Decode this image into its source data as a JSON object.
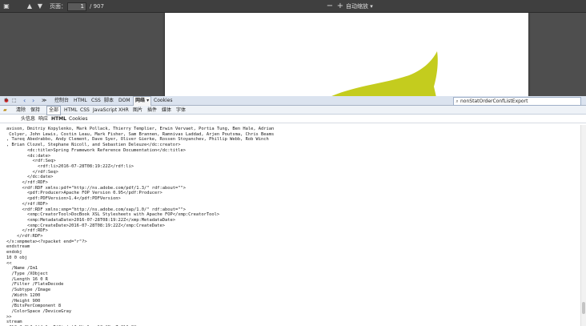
{
  "pdf_viewer": {
    "page_label": "页面：",
    "current_page": "1",
    "total_pages": "/ 907",
    "zoom_out": "−",
    "zoom_in": "+",
    "zoom_value": "自动缩放 ▾",
    "accent_color": "#c4cc1e",
    "prev_icon": "up-arrow",
    "next_icon": "down-arrow"
  },
  "firebug": {
    "tabs": [
      "控制台",
      "HTML",
      "CSS",
      "脚本",
      "DOM",
      "网络 ▾",
      "Cookies"
    ],
    "active_tab": 5,
    "search_value": "nonStatOrderConfListExport",
    "sub_tabs": [
      "清除",
      "保持",
      "全部",
      "HTML",
      "CSS",
      "JavaScript",
      "XHR",
      "图片",
      "插件",
      "媒体",
      "字体"
    ],
    "active_sub_tab": 2,
    "request_tabs": [
      "头信息",
      "响应",
      "HTML",
      "Cookies"
    ],
    "active_request_tab": 2,
    "scroll_thumb": {
      "offset": 0.88,
      "size": 0.06
    },
    "code_lines": [
      "avison, Dmitriy Kopylenko, Mark Pollack, Thierry Templier, Erwin Vervaet, Portia Tung, Ben Hale, Adrian",
      " Colyer, John Lewis, Costin Leau, Mark Fisher, Sam Brannen, Ramnivas Laddad, Arjen Poutsma, Chris Beams",
      ", Tareq Abedrabbo, Andy Clement, Dave Syer, Oliver Gierke, Rossen Stoyanchev, Phillip Webb, Rob Winch",
      ", Brian Clozel, Stephane Nicoll, and Sebastien Deleuze</dc:creator>",
      "        <dc:title>Spring Framework Reference Documentation</dc:title>",
      "        <dc:date>",
      "          <rdf:Seq>",
      "            <rdf:li>2016-07-28T08:19:22Z</rdf:li>",
      "          </rdf:Seq>",
      "        </dc:date>",
      "      </rdf:RDF>",
      "      <rdf:RDF xmlns:pdf=\"http://ns.adobe.com/pdf/1.3/\" rdf:about=\"\">",
      "        <pdf:Producer>Apache FOP Version 0.95</pdf:Producer>",
      "        <pdf:PDFVersion>1.4</pdf:PDFVersion>",
      "      </rdf:RDF>",
      "      <rdf:RDF xmlns:xmp=\"http://ns.adobe.com/xap/1.0/\" rdf:about=\"\">",
      "        <xmp:CreatorTool>DocBook XSL Stylesheets with Apache FOP</xmp:CreatorTool>",
      "        <xmp:MetadataDate>2016-07-28T08:19:22Z</xmp:MetadataDate>",
      "        <xmp:CreateDate>2016-07-28T08:19:22Z</xmp:CreateDate>",
      "      </rdf:RDF>",
      "    </rdf:RDF>",
      "</x:xmpmeta><?xpacket end=\"r\"?>",
      "endstream",
      "endobj",
      "10 0 obj",
      "<<",
      "  /Name /Im1",
      "  /Type /XObject",
      "  /Length 16 0 R",
      "  /Filter /FlateDecode",
      "  /Subtype /Image",
      "  /Width 1200",
      "  /Height 900",
      "  /BitsPerComponent 8",
      "  /ColorSpace /DeviceGray",
      ">>",
      "stream",
      "x?l?e?uCk?;}'{=\"~ P'Ci '~)?~Ki \" , \"?=#K, Zp?l\" \"H=",
      "?,?D~W'   ><'~??'?d?!=?|?ea??b??1?~?!~?\"~?'???????????????????"
    ]
  }
}
